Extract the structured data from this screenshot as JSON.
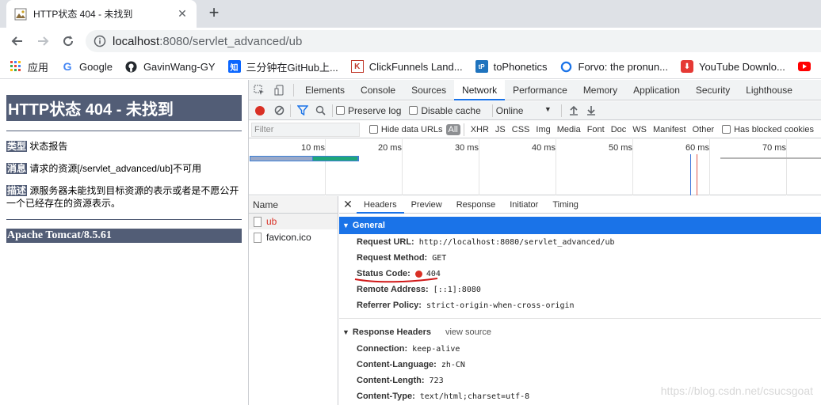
{
  "browser": {
    "tab_title": "HTTP状态 404 - 未找到",
    "url_host": "localhost",
    "url_rest": ":8080/servlet_advanced/ub"
  },
  "bookmarks": [
    {
      "label": "应用",
      "icon": "apps-grid-icon"
    },
    {
      "label": "Google",
      "icon": "google-icon"
    },
    {
      "label": "GavinWang-GY",
      "icon": "github-icon"
    },
    {
      "label": "三分钟在GitHub上...",
      "icon": "zhihu-icon"
    },
    {
      "label": "ClickFunnels Land...",
      "icon": "clickfunnels-icon"
    },
    {
      "label": "toPhonetics",
      "icon": "tophonetics-icon"
    },
    {
      "label": "Forvo: the pronun...",
      "icon": "forvo-icon"
    },
    {
      "label": "YouTube Downlo...",
      "icon": "download-icon"
    }
  ],
  "page": {
    "title": "HTTP状态 404 - 未找到",
    "type_label": "类型",
    "type_value": "状态报告",
    "message_label": "消息",
    "message_value": "请求的资源[/servlet_advanced/ub]不可用",
    "desc_label": "描述",
    "desc_value": "源服务器未能找到目标资源的表示或者是不愿公开一个已经存在的资源表示。",
    "footer": "Apache Tomcat/8.5.61"
  },
  "devtools": {
    "tabs": [
      "Elements",
      "Console",
      "Sources",
      "Network",
      "Performance",
      "Memory",
      "Application",
      "Security",
      "Lighthouse"
    ],
    "active_tab": "Network",
    "preserve_log": "Preserve log",
    "disable_cache": "Disable cache",
    "throttle": "Online",
    "filter_placeholder": "Filter",
    "hide_data_urls": "Hide data URLs",
    "filter_types": [
      "All",
      "XHR",
      "JS",
      "CSS",
      "Img",
      "Media",
      "Font",
      "Doc",
      "WS",
      "Manifest",
      "Other"
    ],
    "blocked_cookies": "Has blocked cookies",
    "timeline_ticks": [
      "10 ms",
      "20 ms",
      "30 ms",
      "40 ms",
      "50 ms",
      "60 ms",
      "70 ms"
    ],
    "list_header": "Name",
    "requests": [
      {
        "name": "ub",
        "color": "#d93025"
      },
      {
        "name": "favicon.ico",
        "color": "#202124"
      }
    ],
    "detail_tabs": [
      "Headers",
      "Preview",
      "Response",
      "Initiator",
      "Timing"
    ],
    "active_detail_tab": "Headers",
    "general_title": "General",
    "general": {
      "request_url_k": "Request URL:",
      "request_url_v": "http://localhost:8080/servlet_advanced/ub",
      "request_method_k": "Request Method:",
      "request_method_v": "GET",
      "status_code_k": "Status Code:",
      "status_code_v": "404",
      "remote_address_k": "Remote Address:",
      "remote_address_v": "[::1]:8080",
      "referrer_policy_k": "Referrer Policy:",
      "referrer_policy_v": "strict-origin-when-cross-origin"
    },
    "response_headers_title": "Response Headers",
    "view_source": "view source",
    "response_headers": {
      "connection_k": "Connection:",
      "connection_v": "keep-alive",
      "content_language_k": "Content-Language:",
      "content_language_v": "zh-CN",
      "content_length_k": "Content-Length:",
      "content_length_v": "723",
      "content_type_k": "Content-Type:",
      "content_type_v": "text/html;charset=utf-8"
    }
  },
  "watermark": "https://blog.csdn.net/csucsgoat",
  "colors": {
    "tomcat_header": "#525d76",
    "accent": "#1a73e8",
    "error": "#d93025"
  }
}
